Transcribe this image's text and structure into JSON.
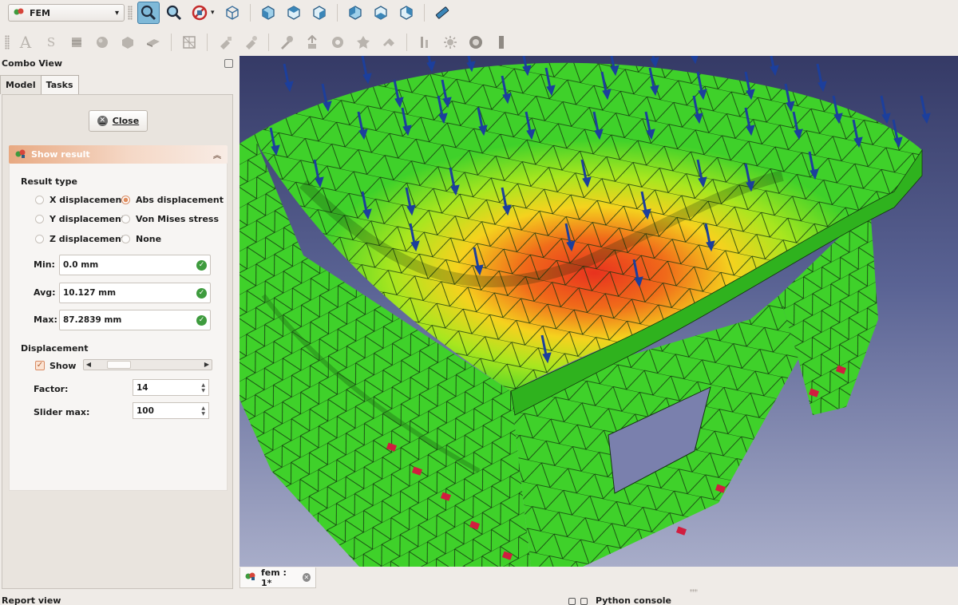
{
  "toolbar": {
    "workbench_label": "FEM",
    "row1_icons": [
      "fit-all-icon",
      "zoom-selection-icon",
      "draw-style-icon",
      "isometric-view-icon",
      "front-view-icon",
      "top-view-icon",
      "right-view-icon",
      "rear-view-icon",
      "bottom-view-icon",
      "left-view-icon",
      "measure-icon"
    ],
    "row2_icons": [
      "analysis-icon",
      "solver-icon",
      "material-icon",
      "sphere-material-icon",
      "box-constraint-icon",
      "beam-section-icon",
      "mesh-icon",
      "fixed-constraint-icon",
      "force-constraint-icon",
      "pressure-constraint-icon",
      "bearing-constraint-icon",
      "gear-constraint-icon",
      "pulley-constraint-icon",
      "displacement-constraint-icon",
      "temperature-icon",
      "heatflux-icon",
      "run-solver-icon",
      "show-result-icon",
      "purge-results-icon"
    ]
  },
  "combo": {
    "title": "Combo View",
    "tabs": [
      "Model",
      "Tasks"
    ],
    "active_tab": "Tasks",
    "close_label": "Close",
    "show_result": {
      "title": "Show result",
      "result_type_label": "Result type",
      "options": [
        "X displacement",
        "Abs displacement",
        "Y displacement",
        "Von Mises stress",
        "Z displacement",
        "None"
      ],
      "selected": "Abs displacement",
      "min_label": "Min:",
      "min_value": "0.0 mm",
      "avg_label": "Avg:",
      "avg_value": "10.127 mm",
      "max_label": "Max:",
      "max_value": "87.2839 mm",
      "displacement_label": "Displacement",
      "show_label": "Show",
      "show_checked": true,
      "slider_fraction": 0.16,
      "factor_label": "Factor:",
      "factor_value": "14",
      "slider_max_label": "Slider max:",
      "slider_max_value": "100"
    }
  },
  "document_tab": {
    "label": "fem : 1*"
  },
  "bottom": {
    "report_view": "Report view",
    "python_console": "Python console"
  },
  "colors": {
    "accent": "#e08c5c",
    "mesh_green": "#3fd12a",
    "hotspot_red": "#e8321e",
    "arrow_blue": "#1c3f9c",
    "fixed_marker": "#d11d3f",
    "view_bg_top": "#353a66",
    "view_bg_bottom": "#a8adc9"
  }
}
